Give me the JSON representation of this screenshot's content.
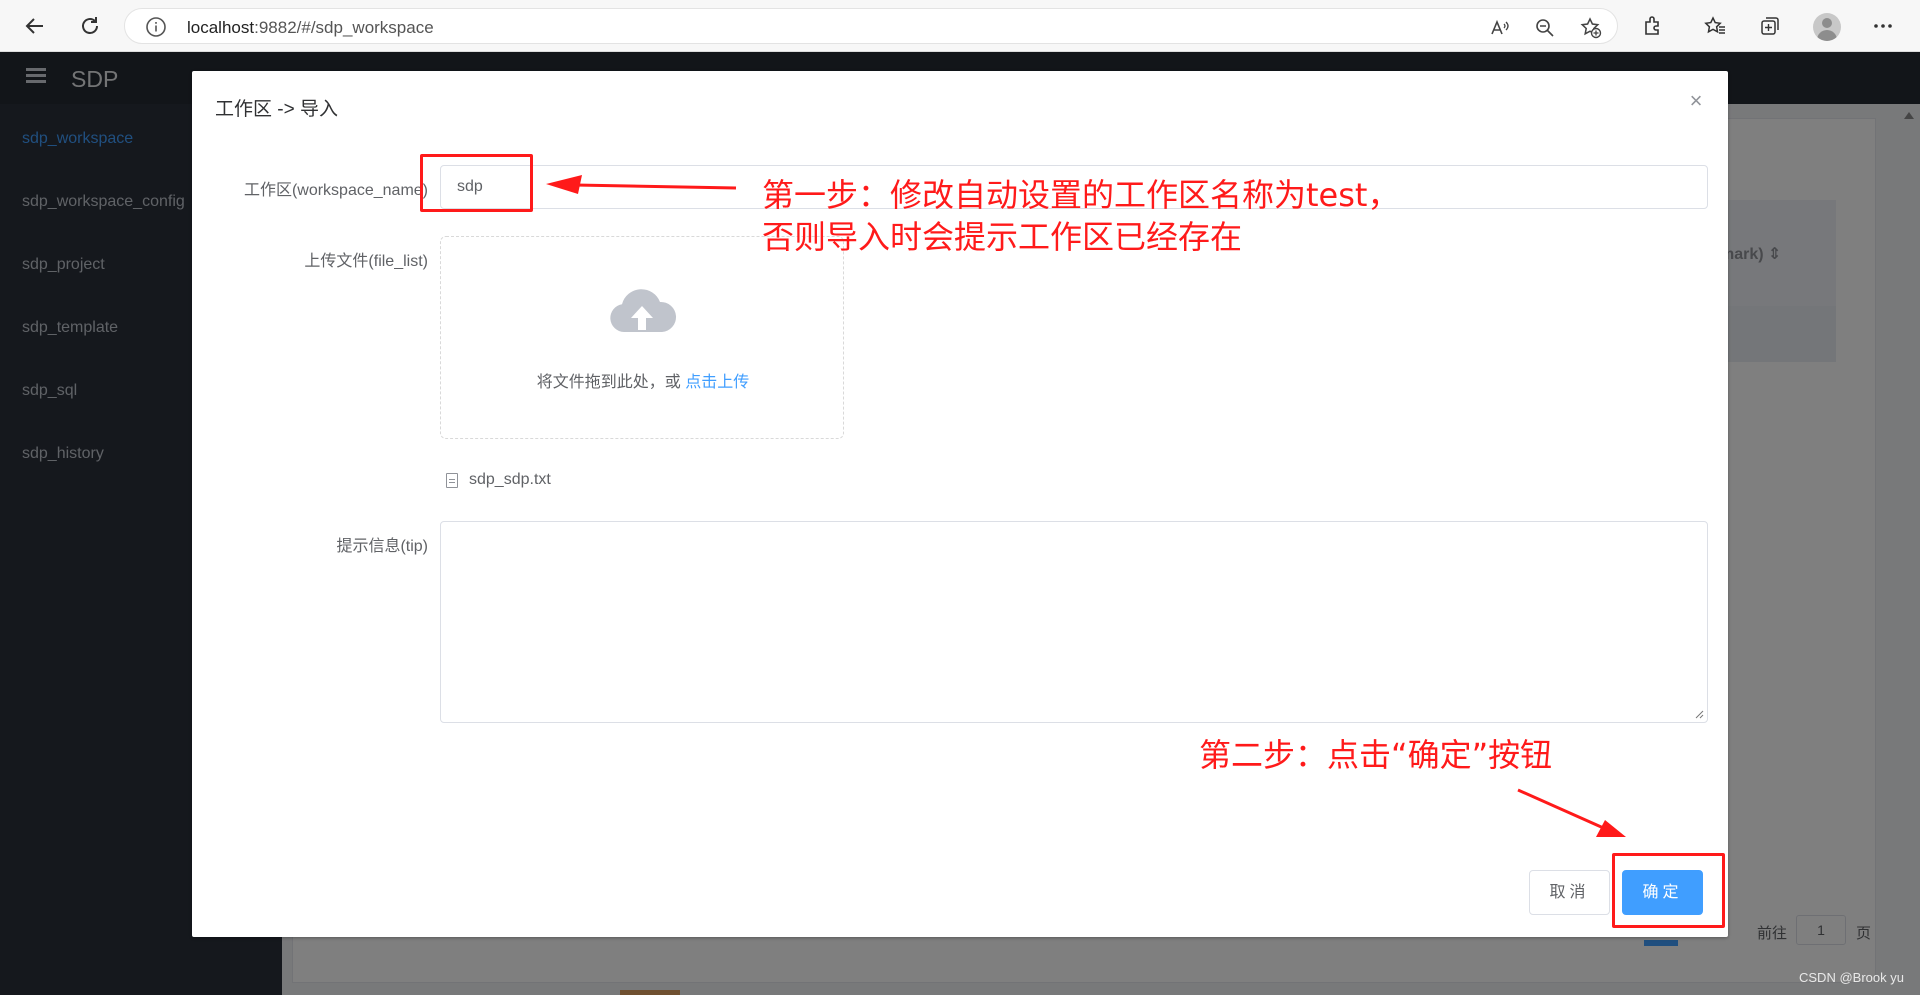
{
  "browser": {
    "url_host": "localhost",
    "url_rest": ":9882/#/sdp_workspace"
  },
  "app": {
    "title": "SDP",
    "sidebar": [
      {
        "label": "sdp_workspace",
        "active": true
      },
      {
        "label": "sdp_workspace_config",
        "active": false
      },
      {
        "label": "sdp_project",
        "active": false
      },
      {
        "label": "sdp_template",
        "active": false
      },
      {
        "label": "sdp_sql",
        "active": false
      },
      {
        "label": "sdp_history",
        "active": false
      }
    ],
    "table_partial_column": "mark)",
    "pagination": {
      "goto_label": "前往",
      "page_value": "1",
      "page_unit": "页"
    }
  },
  "dialog": {
    "title": "工作区 -> 导入",
    "workspace_label": "工作区(workspace_name)",
    "workspace_value": "sdp",
    "upload_label": "上传文件(file_list)",
    "upload_hint": "将文件拖到此处，或",
    "upload_link": "点击上传",
    "file_name": "sdp_sdp.txt",
    "tip_label": "提示信息(tip)",
    "tip_value": "",
    "cancel_label": "取消",
    "confirm_label": "确定"
  },
  "annotations": {
    "step1_line1": "第一步：修改自动设置的工作区名称为test，",
    "step1_line2": "否则导入时会提示工作区已经存在",
    "step2": "第二步：点击“确定”按钮",
    "color": "#ff1a1a"
  },
  "watermark": "CSDN @Brook yu",
  "colors": {
    "primary": "#409eff",
    "header_bg": "#252a33",
    "sidebar_bg": "#2b303b"
  }
}
